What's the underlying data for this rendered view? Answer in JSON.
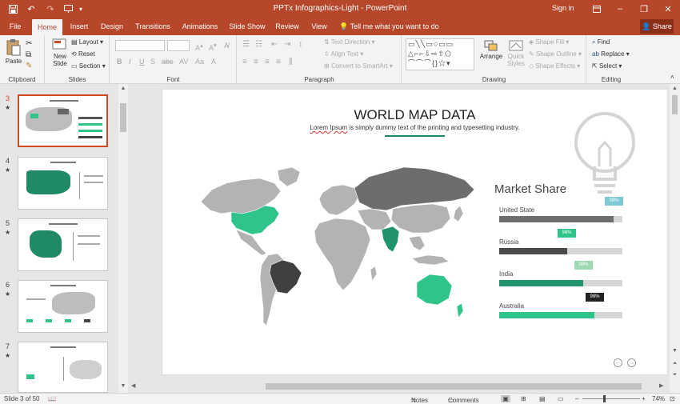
{
  "window": {
    "title": "PPTx Infographics-Light  -  PowerPoint",
    "signin": "Sign in"
  },
  "tabs": [
    {
      "label": "File",
      "active": false
    },
    {
      "label": "Home",
      "active": true
    },
    {
      "label": "Insert",
      "active": false
    },
    {
      "label": "Design",
      "active": false
    },
    {
      "label": "Transitions",
      "active": false
    },
    {
      "label": "Animations",
      "active": false
    },
    {
      "label": "Slide Show",
      "active": false
    },
    {
      "label": "Review",
      "active": false
    },
    {
      "label": "View",
      "active": false
    }
  ],
  "tellme": "Tell me what you want to do",
  "share": "Share",
  "ribbon": {
    "clipboard": {
      "paste": "Paste",
      "label": "Clipboard"
    },
    "slides": {
      "new_slide": "New Slide",
      "layout": "Layout",
      "reset": "Reset",
      "section": "Section",
      "label": "Slides"
    },
    "font": {
      "label": "Font"
    },
    "paragraph": {
      "text_direction": "Text Direction",
      "align_text": "Align Text",
      "convert": "Convert to SmartArt",
      "label": "Paragraph"
    },
    "drawing": {
      "arrange": "Arrange",
      "quick_styles": "Quick Styles",
      "shape_fill": "Shape Fill",
      "shape_outline": "Shape Outline",
      "shape_effects": "Shape Effects",
      "label": "Drawing"
    },
    "editing": {
      "find": "Find",
      "replace": "Replace",
      "select": "Select",
      "label": "Editing"
    }
  },
  "thumbnails": [
    {
      "num": "3",
      "selected": true
    },
    {
      "num": "4",
      "selected": false
    },
    {
      "num": "5",
      "selected": false
    },
    {
      "num": "6",
      "selected": false
    },
    {
      "num": "7",
      "selected": false
    }
  ],
  "slide": {
    "title": "WORLD MAP DATA",
    "subtitle_wavy": "Lorem Ipsum",
    "subtitle_rest": " is simply dummy text of the printing and typesetting industry.",
    "market_title": "Market Share",
    "bars": [
      {
        "label": "United State",
        "value": 0.93,
        "color": "#6d6d6d",
        "badge": "98%",
        "badge_color": "#7fc8d6"
      },
      {
        "label": "Russia",
        "value": 0.55,
        "color": "#4a4a4a",
        "badge": "98%",
        "badge_color": "#2ec48a"
      },
      {
        "label": "India",
        "value": 0.68,
        "color": "#22946b",
        "badge": "98%",
        "badge_color": "#9fd9b4"
      },
      {
        "label": "Australia",
        "value": 0.77,
        "color": "#2ec48a",
        "badge": "98%",
        "badge_color": "#222222"
      }
    ]
  },
  "status": {
    "slide_of": "Slide 3 of 50",
    "notes": "Notes",
    "comments": "Comments",
    "zoom": "74%"
  },
  "colors": {
    "accent": "#b7472a",
    "green": "#2ec48a",
    "dark": "#4a4a4a",
    "land": "#b3b3b3"
  }
}
